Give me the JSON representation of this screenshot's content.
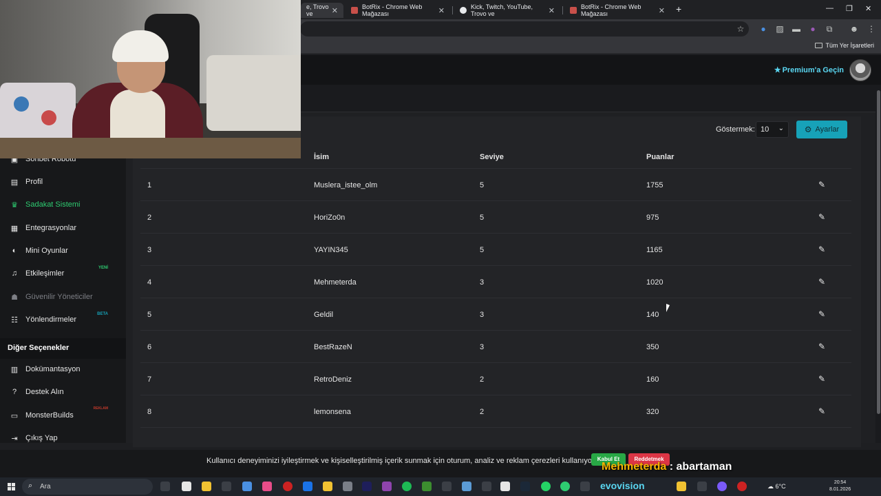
{
  "browser": {
    "tabs": [
      {
        "title": "e, Trovo ve",
        "active": true
      },
      {
        "title": "BotRix - Chrome Web Mağazası",
        "active": false
      },
      {
        "title": "Kick, Twitch, YouTube, Trovo ve",
        "active": false
      },
      {
        "title": "BotRix - Chrome Web Mağazası",
        "active": false
      }
    ],
    "bookmarks_all": "Tüm Yer İşaretleri"
  },
  "header": {
    "premium_label": "Premium'a Geçin"
  },
  "sidebar": {
    "items": [
      {
        "label": "Sohbet Robotu",
        "icon": "robot-icon"
      },
      {
        "label": "Profil",
        "icon": "id-card-icon"
      },
      {
        "label": "Sadakat Sistemi",
        "icon": "trophy-icon",
        "active": true
      },
      {
        "label": "Entegrasyonlar",
        "icon": "plug-icon"
      },
      {
        "label": "Mini Oyunlar",
        "icon": "gamepad-icon"
      },
      {
        "label": "Etkileşimler",
        "icon": "music-icon",
        "badge": "YENİ",
        "badge_color": "#2ecc71"
      },
      {
        "label": "Güvenilir Yöneticiler",
        "icon": "users-icon",
        "muted": true
      },
      {
        "label": "Yönlendirmeler",
        "icon": "user-group-icon",
        "badge": "BETA",
        "badge_color": "#17a2b8"
      }
    ],
    "section_title": "Diğer Seçenekler",
    "other_items": [
      {
        "label": "Dokümantasyon",
        "icon": "book-icon"
      },
      {
        "label": "Destek Alın",
        "icon": "question-icon"
      },
      {
        "label": "MonsterBuilds",
        "icon": "laptop-icon",
        "badge": "REKLAM",
        "badge_color": "#c0392b"
      },
      {
        "label": "Çıkış Yap",
        "icon": "sign-out-icon"
      }
    ]
  },
  "toolbar": {
    "show_label": "Göstermek:",
    "show_value": "10",
    "settings_label": "Ayarlar"
  },
  "table": {
    "headers": [
      "İsim",
      "Seviye",
      "Puanlar"
    ],
    "rows": [
      {
        "rank": "1",
        "name": "Muslera_istee_olm",
        "level": "5",
        "points": "1755"
      },
      {
        "rank": "2",
        "name": "HoriZo0n",
        "level": "5",
        "points": "975"
      },
      {
        "rank": "3",
        "name": "YAYIN345",
        "level": "5",
        "points": "1165"
      },
      {
        "rank": "4",
        "name": "Mehmeterda",
        "level": "3",
        "points": "1020"
      },
      {
        "rank": "5",
        "name": "Geldil",
        "level": "3",
        "points": "140"
      },
      {
        "rank": "6",
        "name": "BestRazeN",
        "level": "3",
        "points": "350"
      },
      {
        "rank": "7",
        "name": "RetroDeniz",
        "level": "2",
        "points": "160"
      },
      {
        "rank": "8",
        "name": "lemonsena",
        "level": "2",
        "points": "320"
      }
    ]
  },
  "cookie": {
    "text": "Kullanıcı deneyiminizi iyileştirmek ve kişiselleştirilmiş içerik sunmak için oturum, analiz ve reklam çerezleri kullanıyoruz.",
    "accept_label": "Kabul Et",
    "reject_label": "Reddetmek"
  },
  "chat_overlay": {
    "user": "Mehmeterda",
    "message": " : abartaman"
  },
  "taskbar": {
    "search_label": "Ara",
    "brand": "evovision",
    "weather": "6°C",
    "time": "20:54",
    "date": "8.01.2026"
  }
}
